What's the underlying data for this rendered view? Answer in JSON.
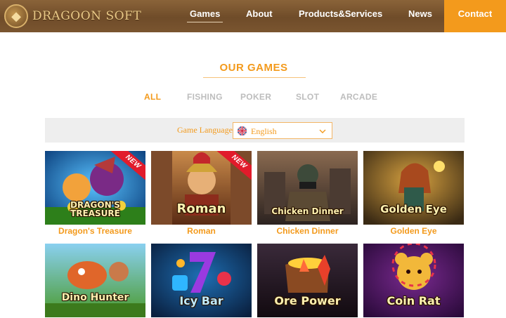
{
  "header": {
    "brand": "DRAGOON SOFT",
    "nav": [
      "Games",
      "About",
      "Products&Services",
      "News"
    ],
    "contact": "Contact"
  },
  "section": {
    "title": "OUR GAMES",
    "filters": [
      "ALL",
      "FISHING",
      "POKER",
      "SLOT",
      "ARCADE"
    ],
    "active_filter": "ALL"
  },
  "language": {
    "label": "Game Language",
    "selected": "English"
  },
  "games": [
    {
      "name": "Dragon's Treasure",
      "logo": "DRAGON'S TREASURE",
      "badge": "NEW"
    },
    {
      "name": "Roman",
      "logo": "Roman",
      "badge": "NEW"
    },
    {
      "name": "Chicken Dinner",
      "logo": "Chicken Dinner"
    },
    {
      "name": "Golden Eye",
      "logo": "Golden Eye"
    },
    {
      "logo": "Dino Hunter"
    },
    {
      "logo": "Icy Bar"
    },
    {
      "logo": "Ore Power"
    },
    {
      "logo": "Coin Rat"
    }
  ],
  "colors": {
    "accent": "#f39a1c",
    "header": "#7a5530",
    "badge": "#e11b2b"
  }
}
